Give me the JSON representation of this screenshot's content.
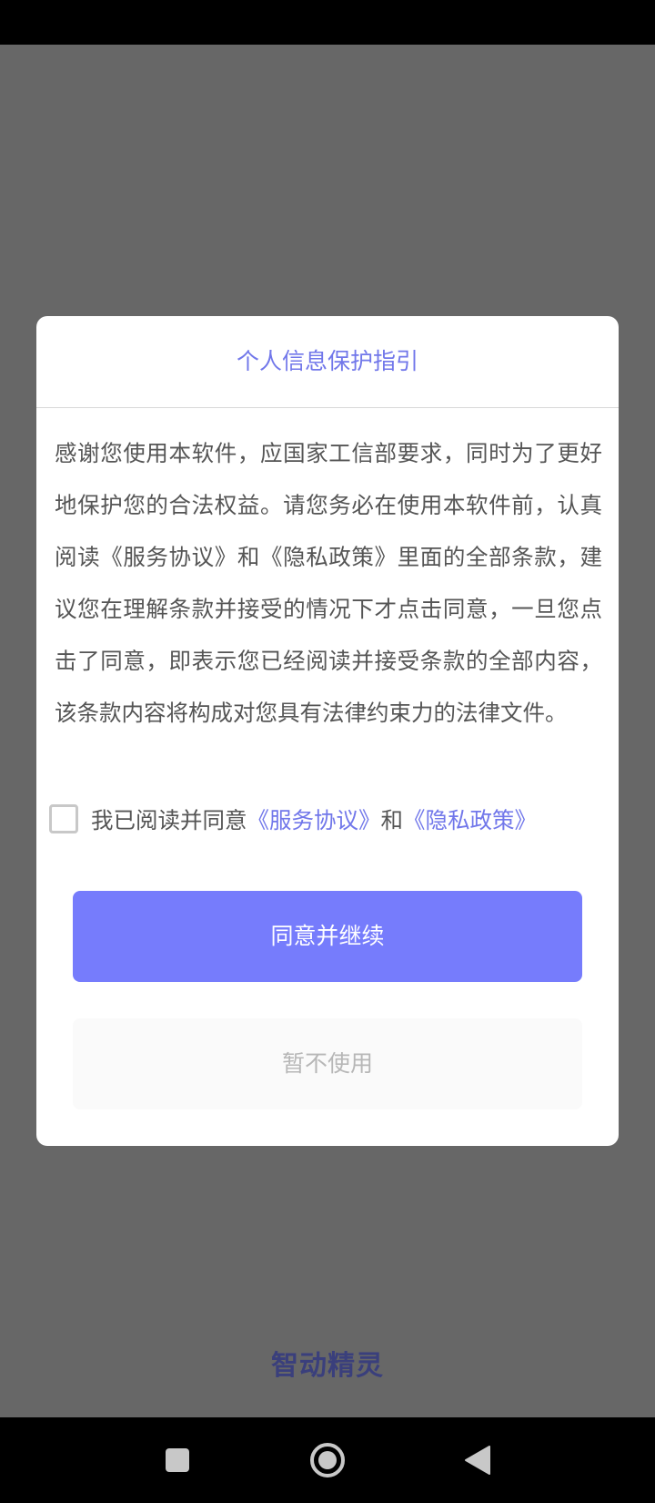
{
  "dialog": {
    "title": "个人信息保护指引",
    "body": "感谢您使用本软件，应国家工信部要求，同时为了更好地保护您的合法权益。请您务必在使用本软件前，认真阅读《服务协议》和《隐私政策》里面的全部条款，建议您在理解条款并接受的情况下才点击同意，一旦您点击了同意，即表示您已经阅读并接受条款的全部内容，该条款内容将构成对您具有法律约束力的法律文件。",
    "agree_prefix": "我已阅读并同意",
    "service_link": "《服务协议》",
    "agree_and": "和",
    "privacy_link": "《隐私政策》",
    "agree_button": "同意并继续",
    "decline_button": "暂不使用"
  },
  "app": {
    "brand": "智动精灵"
  },
  "colors": {
    "accent": "#767cfc",
    "link": "#7177ea",
    "overlay": "#676767",
    "brand": "#3a3f7c"
  },
  "nav": {
    "icons": [
      "square-icon",
      "circle-home-icon",
      "triangle-back-icon"
    ]
  }
}
